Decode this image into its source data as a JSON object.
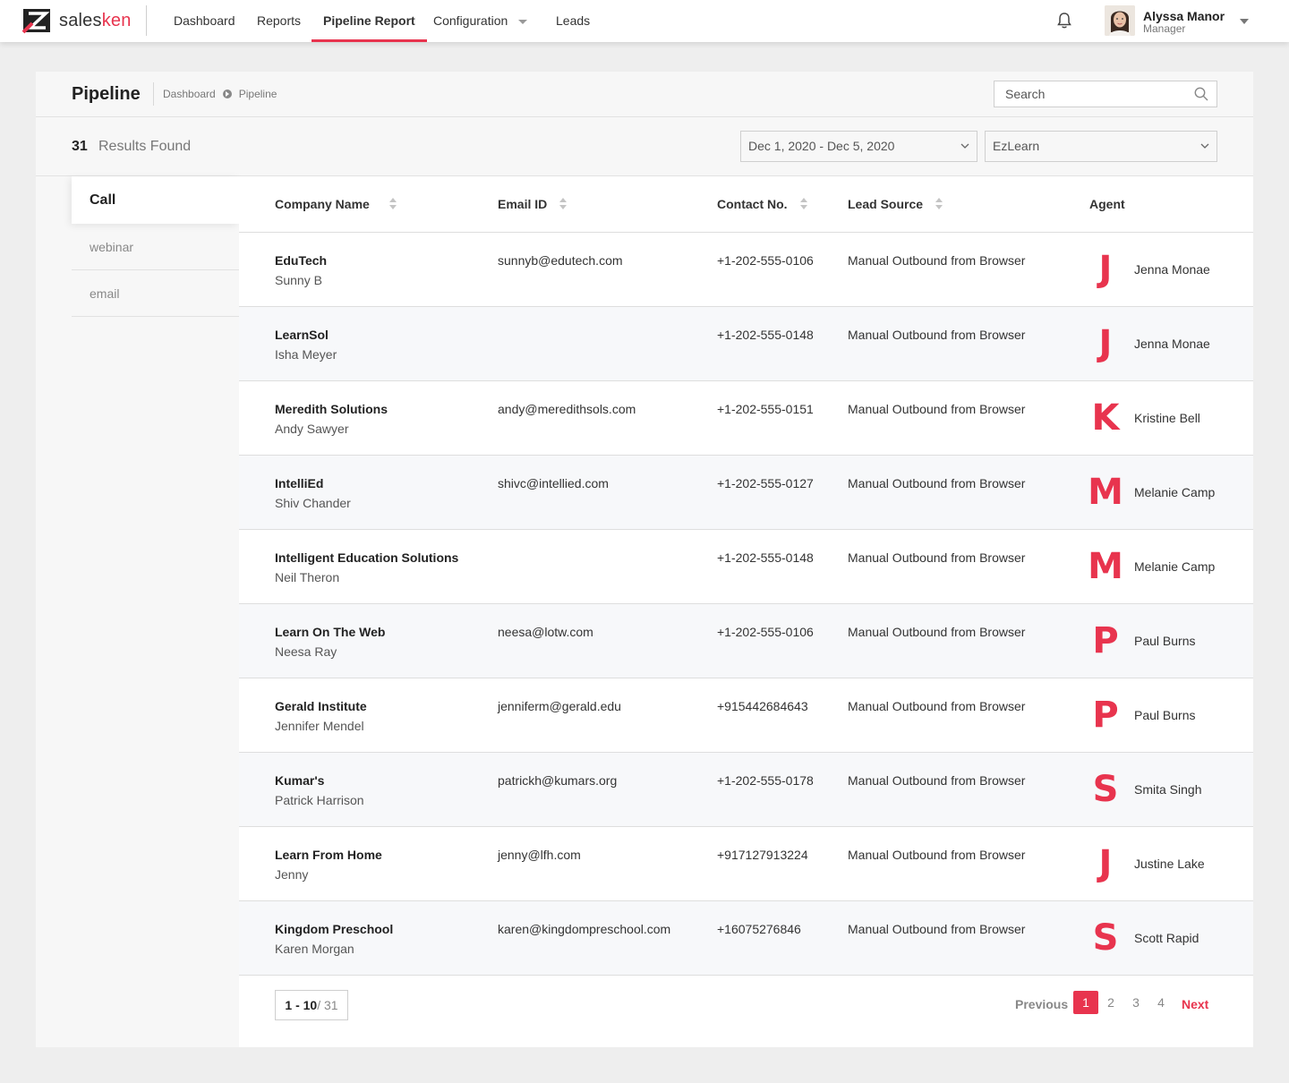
{
  "brand": {
    "name_a": "sales",
    "name_b": "ken",
    "accent": "#e8344e"
  },
  "nav": {
    "items": [
      {
        "label": "Dashboard"
      },
      {
        "label": "Reports"
      },
      {
        "label": "Pipeline Report"
      },
      {
        "label": "Configuration"
      },
      {
        "label": "Leads"
      }
    ],
    "active": "Pipeline Report"
  },
  "user": {
    "name": "Alyssa Manor",
    "role": "Manager"
  },
  "page": {
    "title": "Pipeline",
    "breadcrumb": [
      "Dashboard",
      "Pipeline"
    ],
    "search_placeholder": "Search",
    "results_count": "31",
    "results_label": "Results Found",
    "date_range": "Dec 1, 2020 - Dec 5, 2020",
    "product": "EzLearn"
  },
  "side_tabs": [
    {
      "label": "Call"
    },
    {
      "label": "webinar"
    },
    {
      "label": "email"
    }
  ],
  "table": {
    "columns": [
      "Company Name",
      "Email ID",
      "Contact No.",
      "Lead Source",
      "Agent"
    ],
    "rows": [
      {
        "company": "EduTech",
        "person": "Sunny B",
        "email": "sunnyb@edutech.com",
        "contact": "+1-202-555-0106",
        "source": "Manual Outbound from Browser",
        "agent_initial": "J",
        "agent": "Jenna Monae"
      },
      {
        "company": "LearnSol",
        "person": "Isha Meyer",
        "email": "",
        "contact": "+1-202-555-0148",
        "source": "Manual Outbound from Browser",
        "agent_initial": "J",
        "agent": "Jenna Monae"
      },
      {
        "company": "Meredith Solutions",
        "person": "Andy Sawyer",
        "email": "andy@meredithsols.com",
        "contact": "+1-202-555-0151",
        "source": "Manual Outbound from Browser",
        "agent_initial": "K",
        "agent": "Kristine Bell"
      },
      {
        "company": "IntelliEd",
        "person": "Shiv Chander",
        "email": "shivc@intellied.com",
        "contact": "+1-202-555-0127",
        "source": "Manual Outbound from Browser",
        "agent_initial": "M",
        "agent": "Melanie Camp"
      },
      {
        "company": "Intelligent Education Solutions",
        "person": "Neil Theron",
        "email": "",
        "contact": "+1-202-555-0148",
        "source": "Manual Outbound from Browser",
        "agent_initial": "M",
        "agent": "Melanie Camp"
      },
      {
        "company": "Learn On The Web",
        "person": "Neesa Ray",
        "email": "neesa@lotw.com",
        "contact": "+1-202-555-0106",
        "source": "Manual Outbound from Browser",
        "agent_initial": "P",
        "agent": "Paul Burns"
      },
      {
        "company": "Gerald Institute",
        "person": "Jennifer Mendel",
        "email": "jenniferm@gerald.edu",
        "contact": "+915442684643",
        "source": "Manual Outbound from Browser",
        "agent_initial": "P",
        "agent": "Paul Burns"
      },
      {
        "company": "Kumar's",
        "person": "Patrick Harrison",
        "email": "patrickh@kumars.org",
        "contact": "+1-202-555-0178",
        "source": "Manual Outbound from Browser",
        "agent_initial": "S",
        "agent": "Smita Singh"
      },
      {
        "company": "Learn From Home",
        "person": "Jenny",
        "email": "jenny@lfh.com",
        "contact": "+917127913224",
        "source": "Manual Outbound from Browser",
        "agent_initial": "J",
        "agent": "Justine Lake"
      },
      {
        "company": "Kingdom Preschool",
        "person": "Karen Morgan",
        "email": "karen@kingdompreschool.com",
        "contact": "+16075276846",
        "source": "Manual Outbound from Browser",
        "agent_initial": "S",
        "agent": "Scott Rapid"
      }
    ]
  },
  "pagination": {
    "range": "1 - 10",
    "total": "/ 31",
    "previous": "Previous",
    "pages": [
      "1",
      "2",
      "3",
      "4"
    ],
    "current": "1",
    "next": "Next"
  }
}
